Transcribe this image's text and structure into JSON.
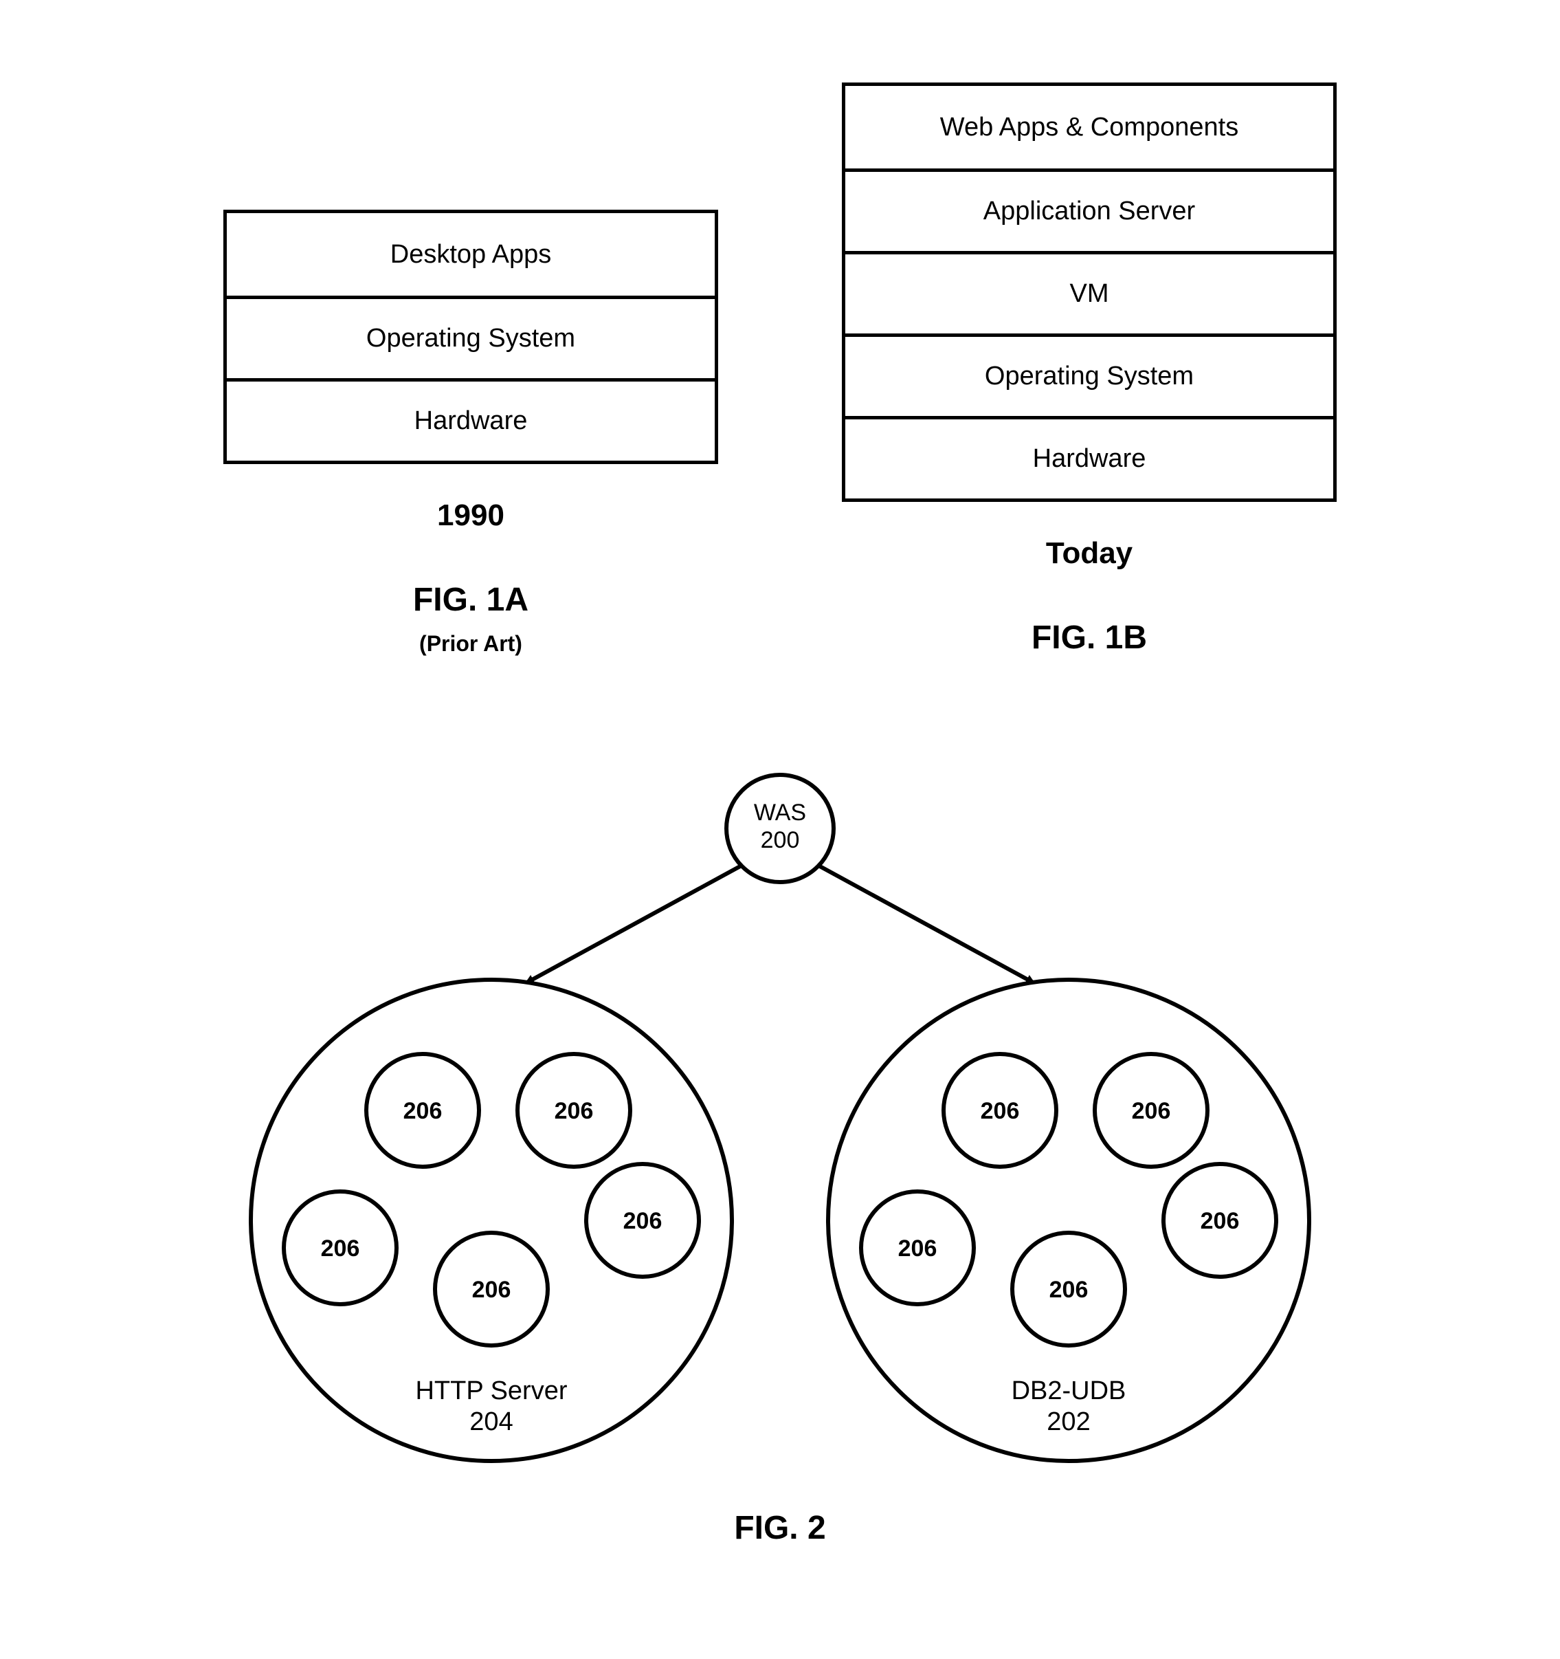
{
  "fig1a": {
    "layers": [
      "Desktop Apps",
      "Operating System",
      "Hardware"
    ],
    "era": "1990",
    "label": "FIG. 1A",
    "sub": "(Prior Art)"
  },
  "fig1b": {
    "layers": [
      "Web Apps & Components",
      "Application Server",
      "VM",
      "Operating System",
      "Hardware"
    ],
    "era": "Today",
    "label": "FIG. 1B"
  },
  "fig2": {
    "root": {
      "line1": "WAS",
      "line2": "200"
    },
    "left_cluster": {
      "title_line1": "HTTP Server",
      "title_line2": "204",
      "nodes": [
        "206",
        "206",
        "206",
        "206",
        "206"
      ]
    },
    "right_cluster": {
      "title_line1": "DB2-UDB",
      "title_line2": "202",
      "nodes": [
        "206",
        "206",
        "206",
        "206",
        "206"
      ]
    },
    "label": "FIG. 2"
  }
}
